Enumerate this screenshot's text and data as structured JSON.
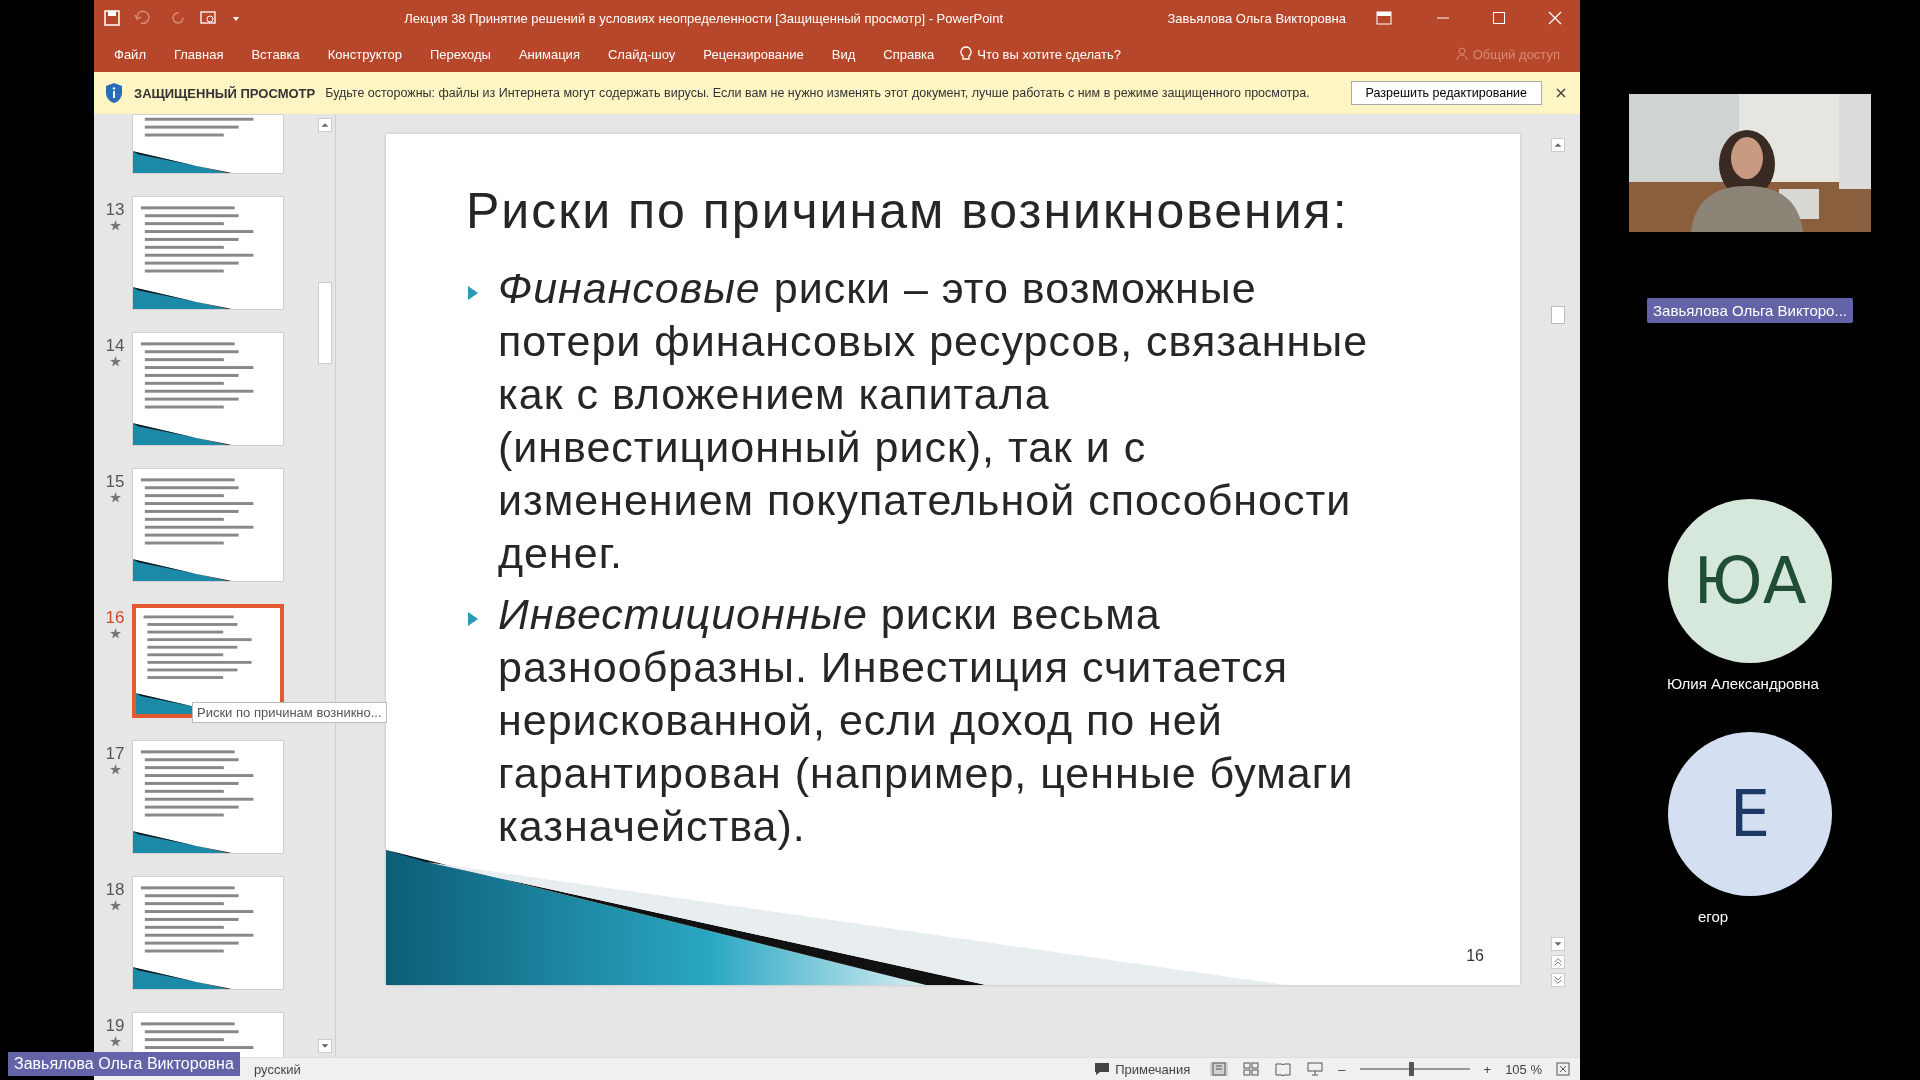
{
  "window": {
    "title": "Лекция 38 Принятие решений в условиях неопределенности [Защищенный просмотр]  -  PowerPoint",
    "user": "Завьялова Ольга Викторовна"
  },
  "menu": [
    {
      "label": "Файл"
    },
    {
      "label": "Главная"
    },
    {
      "label": "Вставка"
    },
    {
      "label": "Конструктор"
    },
    {
      "label": "Переходы"
    },
    {
      "label": "Анимация"
    },
    {
      "label": "Слайд-шоу"
    },
    {
      "label": "Рецензирование"
    },
    {
      "label": "Вид"
    },
    {
      "label": "Справка"
    }
  ],
  "tell_me": "Что вы хотите сделать?",
  "share": {
    "label": "Общий доступ",
    "disabled": true
  },
  "protected_bar": {
    "title": "ЗАЩИЩЕННЫЙ ПРОСМОТР",
    "message": "Будьте осторожны: файлы из Интернета могут содержать вирусы. Если вам не нужно изменять этот документ, лучше работать с ним в режиме защищенного просмотра.",
    "button": "Разрешить редактирование"
  },
  "thumbnails": [
    {
      "selected": false
    },
    {
      "number": "13",
      "selected": false
    },
    {
      "number": "14",
      "selected": false
    },
    {
      "number": "15",
      "selected": false
    },
    {
      "number": "16",
      "selected": true
    },
    {
      "number": "17",
      "selected": false
    },
    {
      "number": "18",
      "selected": false
    },
    {
      "number": "19",
      "selected": false
    }
  ],
  "tooltip": "Риски по причинам возникно...",
  "slide": {
    "title": "Риски по причинам возникновения:",
    "bullets": [
      {
        "text": "*Финансовые* риски – это возможные потери финансовых ресурсов, связанные как с вложением капитала (инвестиционный риск), так и с изменением покупательной способности денег."
      },
      {
        "text": "*Инвестиционные* риски весьма разнообразны.  Инвестиция считается нерискованной, если доход по ней гарантирован (например, ценные бумаги казначейства)."
      }
    ],
    "number": "16"
  },
  "status_bar": {
    "language": "русский",
    "notes": "Примечания",
    "zoom": "105 %",
    "zoom_out": "–",
    "zoom_in": "+",
    "level": 0.48
  },
  "participants": [
    {
      "kind": "video",
      "name": "Завьялова Ольга Викторо..."
    },
    {
      "kind": "avatar",
      "initials": "ЮА",
      "name": "Юлия Александровна",
      "color": "#d6e7dc"
    },
    {
      "kind": "avatar",
      "initials": "Е",
      "name": "егор",
      "color": "#d4e0f1"
    }
  ],
  "presenter_badge": "Завьялова Ольга Викторовна"
}
